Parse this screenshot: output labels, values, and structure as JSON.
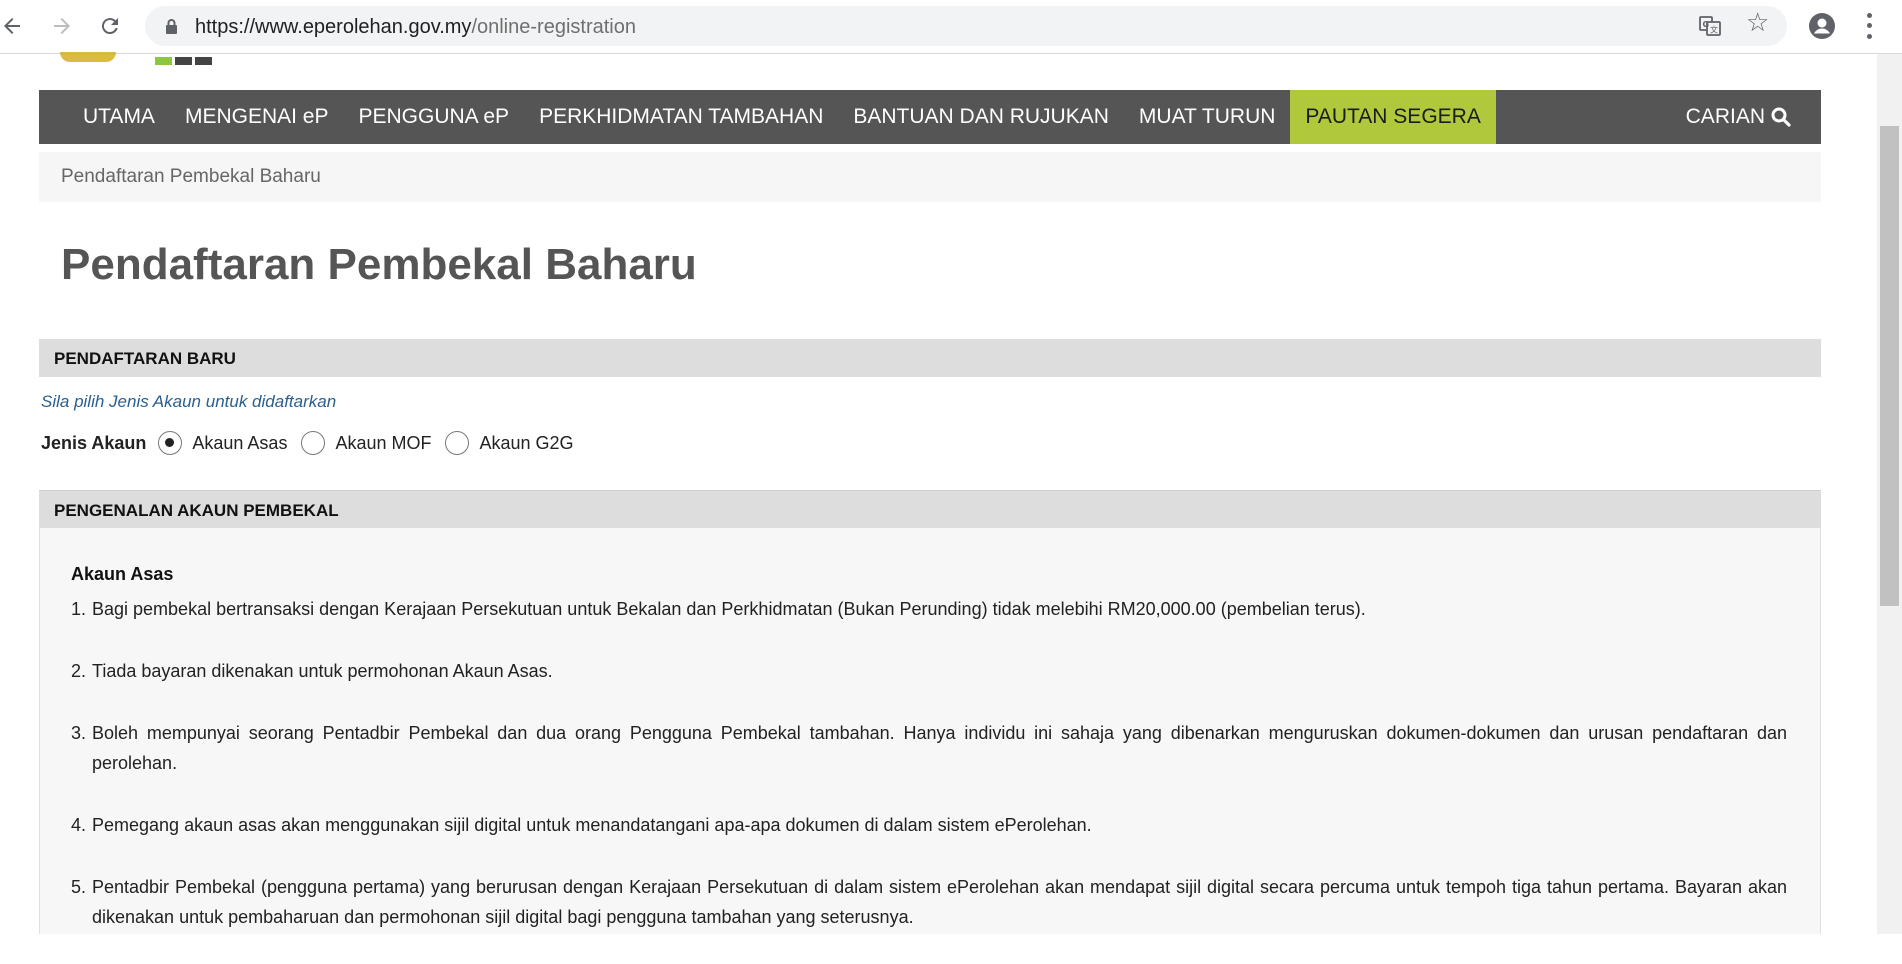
{
  "browser": {
    "url_host": "https://www.eperolehan.gov.my",
    "url_path": "/online-registration"
  },
  "nav": {
    "items": [
      {
        "label": "UTAMA"
      },
      {
        "label": "MENGENAI eP"
      },
      {
        "label": "PENGGUNA eP"
      },
      {
        "label": "PERKHIDMATAN TAMBAHAN"
      },
      {
        "label": "BANTUAN DAN RUJUKAN"
      },
      {
        "label": "MUAT TURUN"
      },
      {
        "label": "PAUTAN SEGERA"
      }
    ],
    "search_label": "CARIAN",
    "active_color": "#afc83c",
    "bar_color": "#555555"
  },
  "breadcrumb": "Pendaftaran Pembekal Baharu",
  "page_title": "Pendaftaran Pembekal Baharu",
  "registration": {
    "header": "PENDAFTARAN BARU",
    "hint": "Sila pilih Jenis Akaun untuk didaftarkan",
    "account_type_label": "Jenis Akaun",
    "options": [
      {
        "label": "Akaun Asas",
        "checked": true
      },
      {
        "label": "Akaun MOF",
        "checked": false
      },
      {
        "label": "Akaun G2G",
        "checked": false
      }
    ]
  },
  "intro": {
    "header": "PENGENALAN AKAUN PEMBEKAL",
    "subtitle": "Akaun Asas",
    "items": [
      {
        "num": "1.",
        "text": "Bagi pembekal bertransaksi dengan Kerajaan Persekutuan untuk Bekalan dan Perkhidmatan (Bukan Perunding) tidak melebihi RM20,000.00 (pembelian terus)."
      },
      {
        "num": "2.",
        "text": "Tiada bayaran dikenakan untuk permohonan Akaun Asas."
      },
      {
        "num": "3.",
        "text": "Boleh mempunyai seorang Pentadbir Pembekal dan dua orang Pengguna Pembekal tambahan. Hanya individu ini sahaja yang dibenarkan menguruskan dokumen-dokumen dan urusan pendaftaran dan perolehan."
      },
      {
        "num": "4.",
        "text": "Pemegang akaun asas akan menggunakan sijil digital untuk menandatangani apa-apa dokumen di dalam sistem ePerolehan."
      },
      {
        "num": "5.",
        "text": "Pentadbir Pembekal (pengguna pertama) yang berurusan dengan Kerajaan Persekutuan di dalam sistem ePerolehan akan mendapat sijil digital secara percuma untuk tempoh tiga tahun pertama. Bayaran akan dikenakan untuk pembaharuan dan permohonan sijil digital bagi pengguna tambahan yang seterusnya."
      }
    ]
  }
}
